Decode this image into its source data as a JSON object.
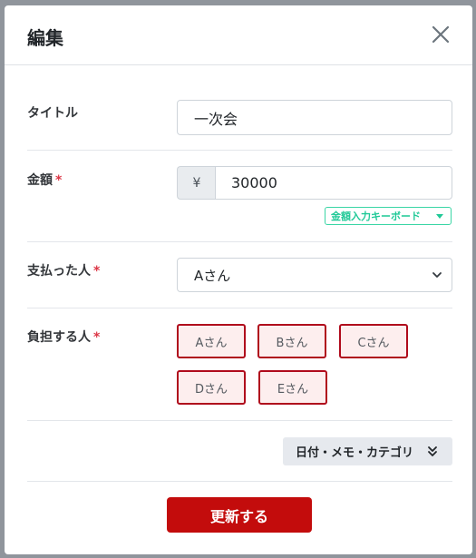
{
  "modal": {
    "title": "編集",
    "close_icon": "close-icon"
  },
  "title_field": {
    "label": "タイトル",
    "value": "一次会"
  },
  "amount_field": {
    "label": "金額",
    "required_mark": "*",
    "currency": "¥",
    "value": "30000",
    "keyboard_button": "金額入力キーボード"
  },
  "payer_field": {
    "label": "支払った人",
    "required_mark": "*",
    "selected": "Aさん"
  },
  "burden_field": {
    "label": "負担する人",
    "required_mark": "*",
    "people": [
      "Aさん",
      "Bさん",
      "Cさん",
      "Dさん",
      "Eさん"
    ]
  },
  "details_button": {
    "label": "日付・メモ・カテゴリ",
    "icon": "double-chevron-down-icon"
  },
  "submit_button": {
    "label": "更新する"
  },
  "colors": {
    "accent": "#c30c0c",
    "chip_border": "#b00b1c",
    "chip_bg": "#fdeeee",
    "keyboard_accent": "#20c997",
    "required": "#dc3545"
  }
}
